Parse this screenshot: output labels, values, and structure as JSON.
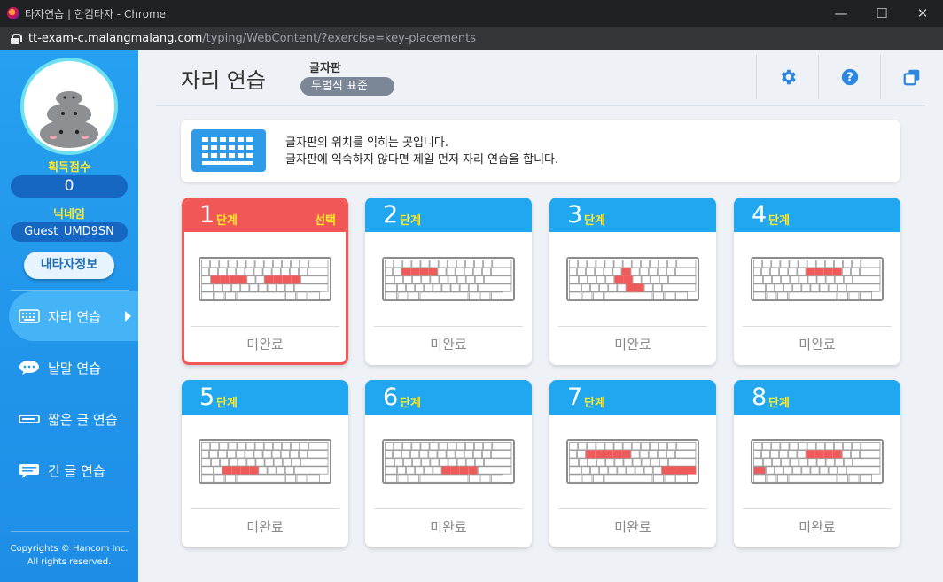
{
  "window": {
    "title": "타자연습 | 한컴타자 - Chrome"
  },
  "address": {
    "host": "tt-exam-c.malangmalang.com",
    "path": "/typing/WebContent/?exercise=key-placements"
  },
  "sidebar": {
    "score_label": "획득점수",
    "score": "0",
    "nick_label": "닉네임",
    "nickname": "Guest_UMD9SN",
    "myinfo_button": "내타자정보",
    "menu": [
      {
        "label": "자리 연습",
        "icon": "keyboard-icon",
        "active": true
      },
      {
        "label": "낱말 연습",
        "icon": "speech-bubble-icon",
        "active": false
      },
      {
        "label": "짧은 글 연습",
        "icon": "short-text-icon",
        "active": false
      },
      {
        "label": "긴 글 연습",
        "icon": "long-text-icon",
        "active": false
      }
    ],
    "copyright_line1": "Copyrights © Hancom Inc.",
    "copyright_line2": "All rights reserved."
  },
  "header": {
    "title": "자리 연습",
    "keyboard_label": "글자판",
    "keyboard_value": "두벌식 표준"
  },
  "info": {
    "line1": "글자판의 위치를 익히는 곳입니다.",
    "line2": "글자판에 익숙하지 않다면 제일 먼저 자리 연습을 합니다."
  },
  "stages": [
    {
      "num": "1",
      "step": "단계",
      "selected_label": "선택",
      "status": "미완료"
    },
    {
      "num": "2",
      "step": "단계",
      "status": "미완료"
    },
    {
      "num": "3",
      "step": "단계",
      "status": "미완료"
    },
    {
      "num": "4",
      "step": "단계",
      "status": "미완료"
    },
    {
      "num": "5",
      "step": "단계",
      "status": "미완료"
    },
    {
      "num": "6",
      "step": "단계",
      "status": "미완료"
    },
    {
      "num": "7",
      "step": "단계",
      "status": "미완료"
    },
    {
      "num": "8",
      "step": "단계",
      "status": "미완료"
    }
  ],
  "colors": {
    "accent": "#20a7f0",
    "selected": "#f25757",
    "highlight_key": "#ef5b5b",
    "step_text": "#ffe82a"
  }
}
